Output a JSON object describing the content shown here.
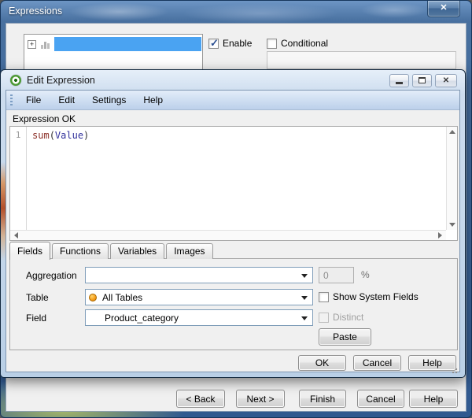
{
  "parent_window": {
    "title": "Expressions",
    "enable_label": "Enable",
    "enable_checked": true,
    "conditional_label": "Conditional",
    "conditional_checked": false,
    "conditional_value": "",
    "wizard_buttons": {
      "back": "< Back",
      "next": "Next >",
      "finish": "Finish",
      "cancel": "Cancel",
      "help": "Help"
    }
  },
  "dialog": {
    "title": "Edit Expression",
    "menu": [
      "File",
      "Edit",
      "Settings",
      "Help"
    ],
    "status_text": "Expression OK",
    "editor": {
      "line_number": "1",
      "code": {
        "function": "sum",
        "paren_open": "(",
        "argument": "Value",
        "paren_close": ")"
      }
    },
    "tabs": [
      {
        "label": "Fields",
        "active": true
      },
      {
        "label": "Functions",
        "active": false
      },
      {
        "label": "Variables",
        "active": false
      },
      {
        "label": "Images",
        "active": false
      }
    ],
    "fields_tab": {
      "aggregation_label": "Aggregation",
      "aggregation_value": "",
      "percent_value": "0",
      "percent_sign": "%",
      "table_label": "Table",
      "table_value": "All Tables",
      "field_label": "Field",
      "field_value": "Product_category",
      "show_system_fields_label": "Show System Fields",
      "show_system_fields_checked": false,
      "distinct_label": "Distinct",
      "distinct_enabled": false,
      "paste_label": "Paste"
    },
    "buttons": {
      "ok": "OK",
      "cancel": "Cancel",
      "help": "Help"
    }
  },
  "icons": {
    "close_glyph": "✕",
    "check_glyph": "✓",
    "expander_glyph": "+"
  },
  "colors": {
    "selection_blue": "#4aa3f2",
    "all_tables_orange": "#f59c1a",
    "code_function": "#8a2d25",
    "code_argument": "#31319c"
  }
}
